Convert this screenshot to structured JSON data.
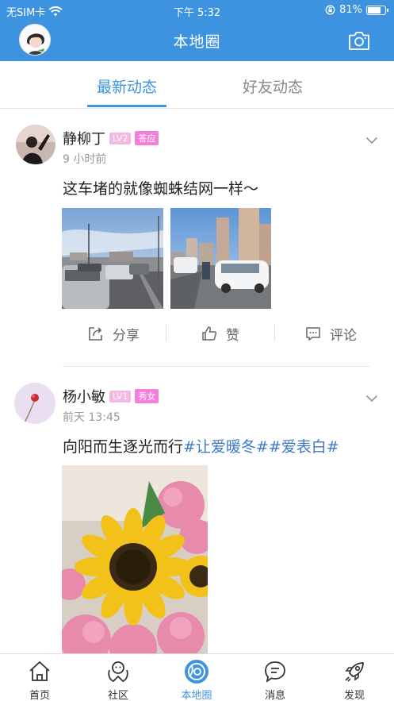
{
  "status_bar": {
    "carrier": "无SIM卡",
    "time": "下午 5:32",
    "battery": "81%",
    "battery_level": 0.81
  },
  "header": {
    "title": "本地圈"
  },
  "tabs": [
    {
      "label": "最新动态",
      "active": true
    },
    {
      "label": "好友动态",
      "active": false
    }
  ],
  "posts": [
    {
      "author": "静柳丁",
      "level": "LV2",
      "tag": "答应",
      "time": "9 小时前",
      "text": "这车堵的就像蜘蛛结网一样～",
      "topics": [],
      "actions": {
        "share": "分享",
        "like": "赞",
        "comment": "评论"
      }
    },
    {
      "author": "杨小敏",
      "level": "LV1",
      "tag": "秀女",
      "time": "前天 13:45",
      "text": "向阳而生逐光而行",
      "topics": [
        "#让爱暖冬#",
        "#爱表白#"
      ]
    }
  ],
  "tabbar": {
    "items": [
      {
        "label": "首页",
        "icon": "home-icon",
        "active": false
      },
      {
        "label": "社区",
        "icon": "community-icon",
        "active": false
      },
      {
        "label": "本地圈",
        "icon": "local-circle-icon",
        "active": true
      },
      {
        "label": "消息",
        "icon": "message-icon",
        "active": false
      },
      {
        "label": "发现",
        "icon": "rocket-icon",
        "active": false
      }
    ]
  },
  "colors": {
    "accent": "#3d93e0",
    "topic": "#3d78c7",
    "badge_level": "#f5b8e3",
    "badge_tag": "#f57ed8"
  }
}
